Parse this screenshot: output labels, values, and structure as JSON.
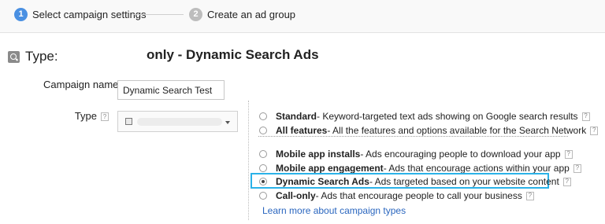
{
  "stepper": {
    "steps": [
      {
        "number": "1",
        "label": "Select campaign settings",
        "active": true,
        "color": "#4a90e2"
      },
      {
        "number": "2",
        "label": "Create an ad group",
        "active": false,
        "color": "#bdbdbd"
      }
    ]
  },
  "type_section": {
    "icon": "magnifier-icon",
    "label": "Type:",
    "value": "only - Dynamic Search Ads"
  },
  "campaign_name": {
    "label": "Campaign name",
    "value": "Dynamic Search Test"
  },
  "type_field": {
    "label": "Type",
    "help": "?"
  },
  "options": [
    {
      "title": "Standard",
      "desc": " - Keyword-targeted text ads showing on Google search results",
      "checked": false
    },
    {
      "title": "All features",
      "desc": " - All the features and options available for the Search Network",
      "checked": false
    },
    {
      "title": "Mobile app installs",
      "desc": " - Ads encouraging people to download your app",
      "checked": false
    },
    {
      "title": "Mobile app engagement",
      "desc": " - Ads that encourage actions within your app",
      "checked": false
    },
    {
      "title": "Dynamic Search Ads",
      "desc": " - Ads targeted based on your website content",
      "checked": true
    },
    {
      "title": "Call-only",
      "desc": " - Ads that encourage people to call your business",
      "checked": false
    }
  ],
  "help_mark": "?",
  "learn_more": "Learn more about campaign types",
  "colors": {
    "highlight": "#2bb2e8",
    "link": "#2a66bf"
  }
}
